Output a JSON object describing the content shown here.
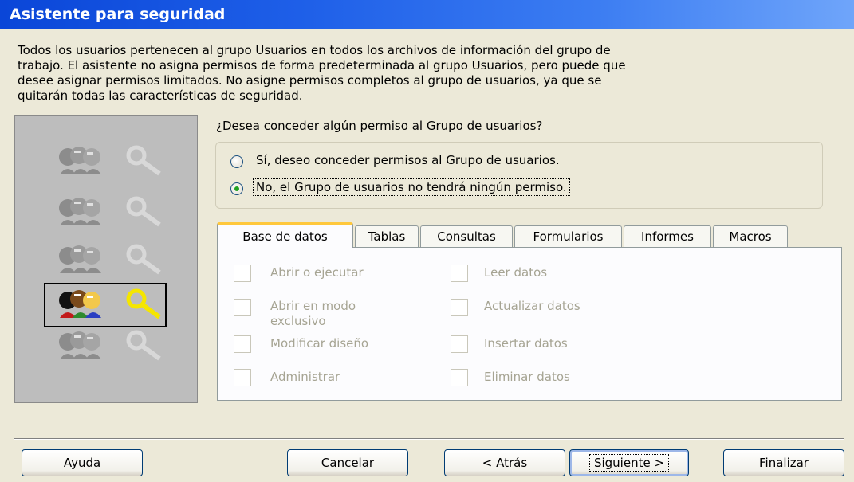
{
  "window": {
    "title": "Asistente para seguridad"
  },
  "intro_text": "Todos los usuarios pertenecen al grupo Usuarios en todos los archivos de información del grupo de\ntrabajo. El asistente no asigna permisos de forma predeterminada al grupo Usuarios, pero puede que\ndesee asignar permisos limitados. No asigne permisos completos al grupo de usuarios, ya que se\nquitarán todas las características de seguridad.",
  "question": "¿Desea conceder algún permiso al Grupo de usuarios?",
  "radios": [
    {
      "label": "Sí, deseo conceder  permisos al Grupo de usuarios.",
      "selected": false
    },
    {
      "label": "No, el Grupo de usuarios no tendrá ningún permiso.",
      "selected": true
    }
  ],
  "tabs": [
    "Base de datos",
    "Tablas",
    "Consultas",
    "Formularios",
    "Informes",
    "Macros"
  ],
  "active_tab": "Base de datos",
  "permissions": {
    "left": [
      "Abrir o ejecutar",
      "Abrir en modo exclusivo",
      "Modificar diseño",
      "Administrar"
    ],
    "right": [
      "Leer datos",
      "Actualizar datos",
      "Insertar datos",
      "Eliminar datos"
    ]
  },
  "wizard_steps": {
    "total": 5,
    "current": 4
  },
  "buttons": {
    "help": "Ayuda",
    "cancel": "Cancelar",
    "back": "< Atrás",
    "next": "Siguiente >",
    "finish": "Finalizar"
  },
  "icons": {
    "step": "users-and-key-icon",
    "radio": "radio-button-icon",
    "checkbox": "checkbox-icon"
  },
  "colors": {
    "titlebar": "#0A46D8",
    "dialog_bg": "#ECE9D8",
    "active_tab_accent": "#FFC83C",
    "radio_dot": "#21A121",
    "disabled_text": "#A6A493"
  }
}
